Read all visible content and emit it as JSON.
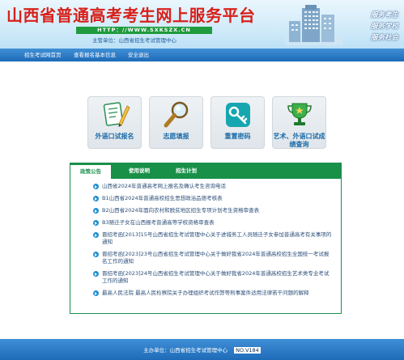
{
  "header": {
    "title": "山西省普通高考考生网上服务平台",
    "url": "HTTP：//WWW.SXKSZX.CN",
    "sponsor": "主管单位：山西省招生考试管理中心",
    "services": [
      "服务考生",
      "服务学校",
      "服务社会"
    ]
  },
  "nav": {
    "items": [
      {
        "label": "招生考试网首页"
      },
      {
        "label": "查看报名基本信息"
      },
      {
        "label": "安全退出"
      }
    ]
  },
  "tiles": [
    {
      "label": "外语口试报名",
      "icon": "form-pen-icon"
    },
    {
      "label": "志愿填报",
      "icon": "magnifier-icon"
    },
    {
      "label": "重置密码",
      "icon": "key-icon"
    },
    {
      "label": "艺术、外语口试成绩查询",
      "icon": "trophy-icon"
    }
  ],
  "notice": {
    "tabs": [
      {
        "label": "政策公告",
        "active": true
      },
      {
        "label": "使用说明",
        "active": false
      },
      {
        "label": "招生计划",
        "active": false
      }
    ],
    "items": [
      "山西省2024年普通高考网上报名及确认考生咨询电话",
      "B1山西省2024年普通高校招生思想政治品德考核表",
      "B2山西省2024年面向农村和脱贫地区招生专项计划考生资格审查表",
      "B3随迁子女在山西报考普通高等学校资格审查表",
      "晋招考函[2013]15号山西省招生考试管理中心关于进城务工人员随迁子女参加普通高考有关事项的通知",
      "晋招考函[2023]23号山西省招生考试管理中心关于做好我省2024年普通高校招生全国统一考试报名工作的通知",
      "晋招考函[2023]24号山西省招生考试管理中心关于做好我省2024年普通高校招生艺术类专业考试工作的通知",
      "最高人民法院 最高人民检察院关于办理组织考试作弊等刑事案件适用法律若干问题的解释"
    ]
  },
  "footer": {
    "text": "主办单位：山西省招生考试管理中心",
    "no": "NO.V184"
  },
  "colors": {
    "title_red": "#d8201a",
    "nav_blue": "#1e6bb8",
    "panel_green": "#189048",
    "link_blue": "#2a4e78"
  }
}
